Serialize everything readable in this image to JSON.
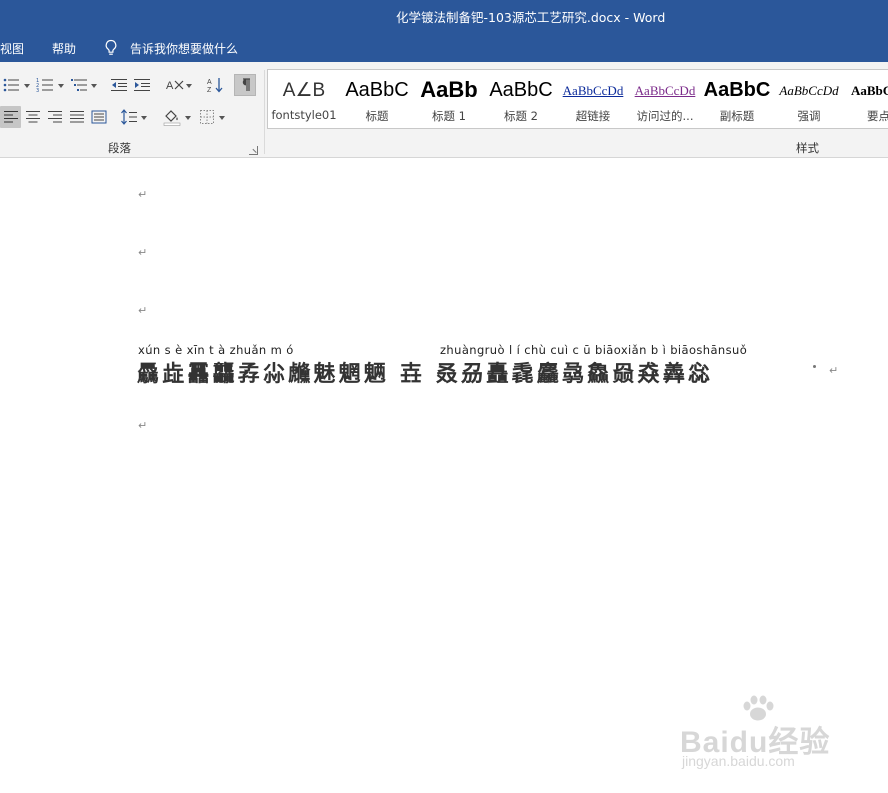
{
  "window": {
    "title": "化学镀法制备钯-103源芯工艺研究.docx  -  Word"
  },
  "menubar": {
    "items": [
      {
        "label": "视图"
      },
      {
        "label": "帮助"
      }
    ],
    "tell_me": "告诉我你想要做什么"
  },
  "ribbon": {
    "paragraph_group_label": "段落",
    "styles_group_label": "样式",
    "styles": [
      {
        "preview": "A∠B",
        "name": "fontstyle01"
      },
      {
        "preview": "AaBbC",
        "name": "标题"
      },
      {
        "preview": "AaBb",
        "name": "标题 1"
      },
      {
        "preview": "AaBbC",
        "name": "标题 2"
      },
      {
        "preview": "AaBbCcDd",
        "name": "超链接"
      },
      {
        "preview": "AaBbCcDd",
        "name": "访问过的..."
      },
      {
        "preview": "AaBbC",
        "name": "副标题"
      },
      {
        "preview": "AaBbCcDd",
        "name": "强调"
      },
      {
        "preview": "AaBbC",
        "name": "要点"
      }
    ]
  },
  "document": {
    "paragraph_mark": "↵",
    "pinyin_left": "xún s è xīn t à zhuǎn m ó",
    "pinyin_right": "zhuàngruò l í chù cuì c ū biāoxiǎn b ì biāoshānsuǒ",
    "hanzi_line": "驫歮靐龘孨尛虪魅魍魉 壵 叒刕矗毳麤骉鱻赑猋羴惢"
  },
  "watermark": {
    "main": "Baidu经验",
    "sub": "jingyan.baidu.com"
  },
  "colors": {
    "title_bar": "#2b579a",
    "ribbon_bg": "#f3f3f3"
  }
}
